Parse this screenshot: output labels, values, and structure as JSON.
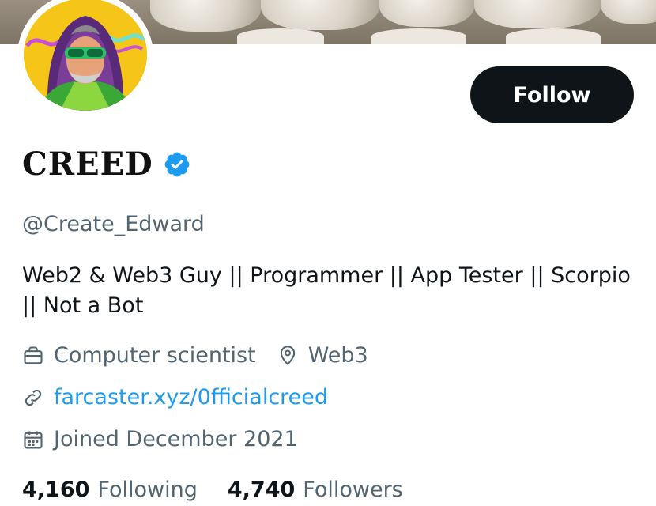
{
  "profile": {
    "display_name": "CREED",
    "handle": "@Create_Edward",
    "bio": "Web2 & Web3 Guy || Programmer || App Tester || Scorpio || Not a Bot",
    "verified": true,
    "follow_label": "Follow"
  },
  "meta": {
    "profession": "Computer scientist",
    "location": "Web3",
    "website": "farcaster.xyz/0fficialcreed",
    "joined": "Joined December 2021"
  },
  "stats": {
    "following_count": "4,160",
    "following_label": "Following",
    "followers_count": "4,740",
    "followers_label": "Followers"
  },
  "colors": {
    "accent": "#1d9bf0",
    "button_bg": "#0f1419",
    "secondary_text": "#536471",
    "avatar_bg": "#f5c518"
  },
  "icons": {
    "verified": "verified-badge-icon",
    "profession": "briefcase-icon",
    "location": "location-pin-icon",
    "website": "link-icon",
    "joined": "calendar-icon"
  }
}
